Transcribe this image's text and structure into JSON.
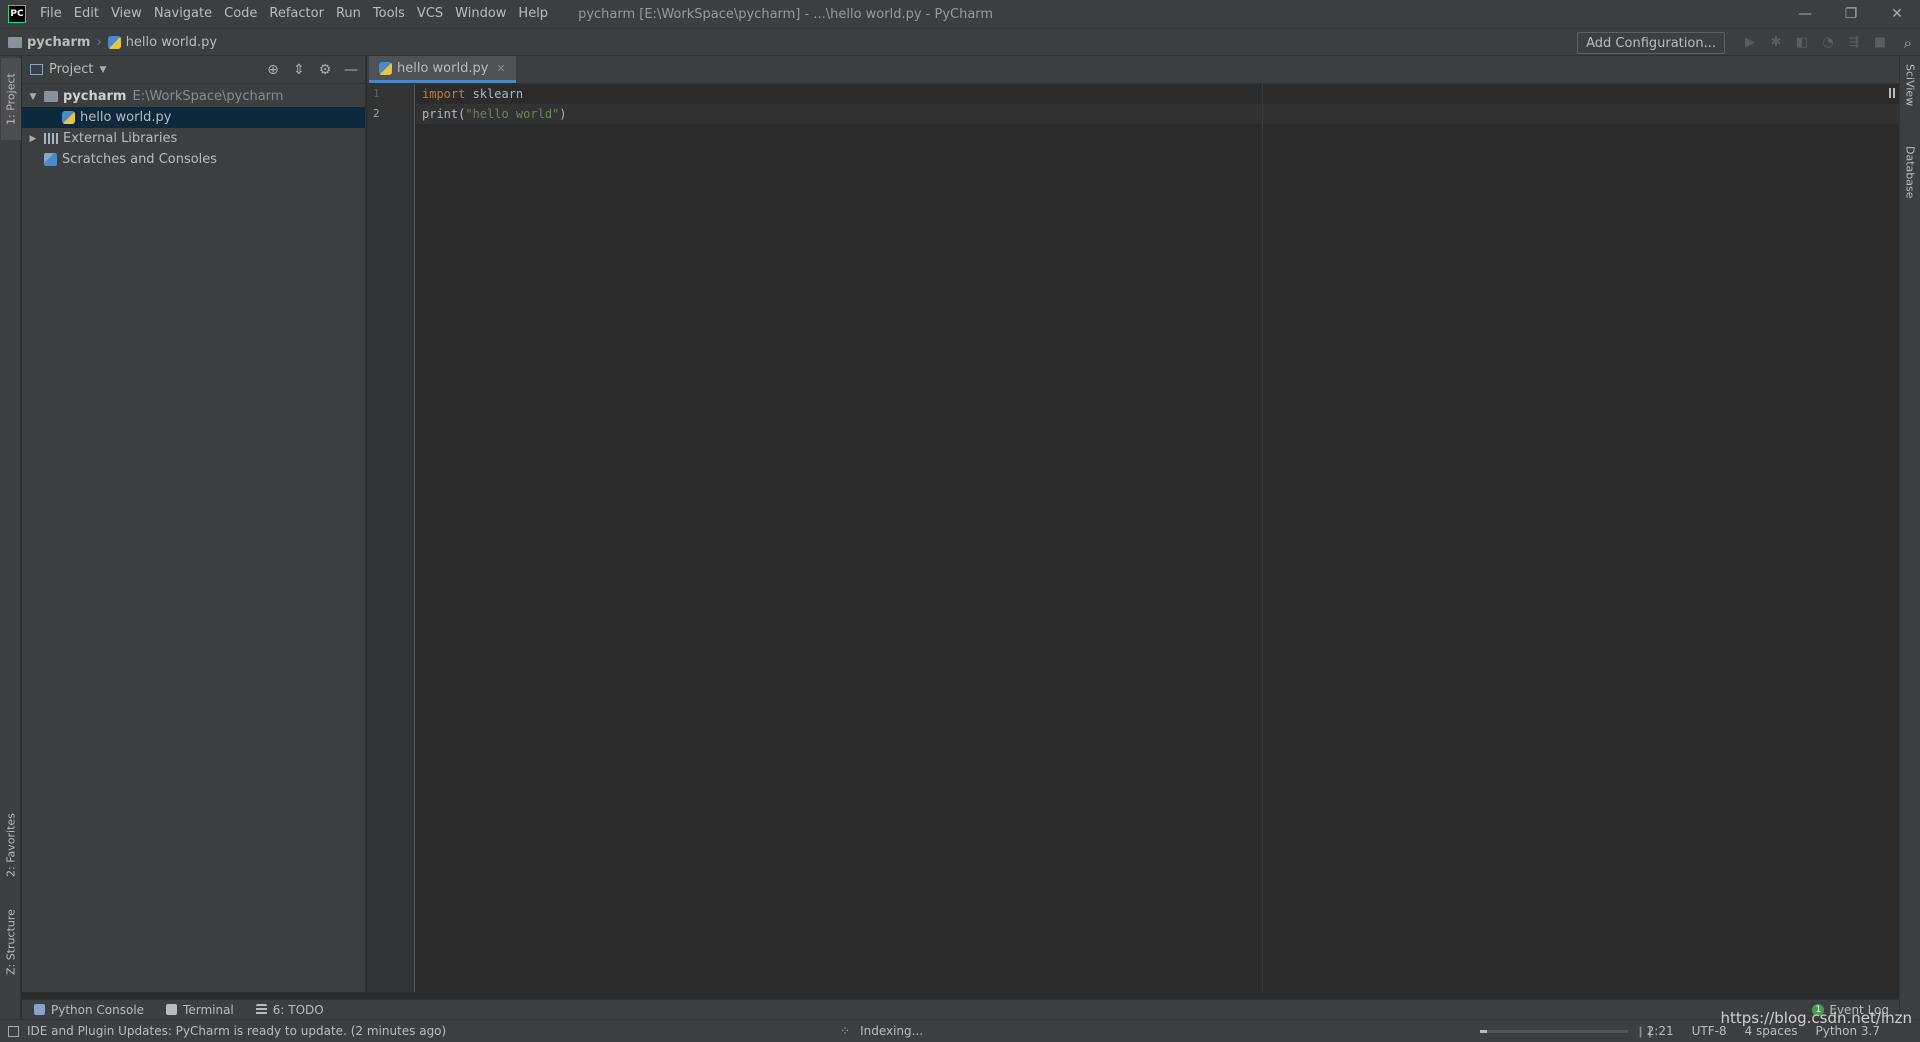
{
  "app": {
    "logo": "PC",
    "window_title": "pycharm [E:\\WorkSpace\\pycharm] - ...\\hello world.py - PyCharm"
  },
  "menu": [
    "File",
    "Edit",
    "View",
    "Navigate",
    "Code",
    "Refactor",
    "Run",
    "Tools",
    "VCS",
    "Window",
    "Help"
  ],
  "window_controls": {
    "minimize": "—",
    "restore": "❐",
    "close": "✕"
  },
  "navbar": {
    "root": "pycharm",
    "file": "hello world.py",
    "add_configuration": "Add Configuration..."
  },
  "left_stripe": {
    "project": "1: Project",
    "favorites": "2: Favorites",
    "structure": "Z: Structure"
  },
  "right_stripe": {
    "sciview": "SciView",
    "database": "Database"
  },
  "project_panel": {
    "title": "Project",
    "tree": [
      {
        "label": "pycharm",
        "path": "E:\\WorkSpace\\pycharm"
      },
      {
        "label": "hello world.py"
      },
      {
        "label": "External Libraries"
      },
      {
        "label": "Scratches and Consoles"
      }
    ]
  },
  "editor": {
    "tab_label": "hello world.py",
    "line_numbers": [
      "1",
      "2"
    ],
    "lines": [
      {
        "kw": "import",
        "rest": " sklearn"
      },
      {
        "fn": "print(",
        "str": "\"hello world\"",
        "end": ")"
      }
    ]
  },
  "toolwindows": {
    "python_console": "Python Console",
    "terminal": "Terminal",
    "todo": "6: TODO",
    "event_log": "Event Log",
    "event_count": "1"
  },
  "status": {
    "message": "IDE and Plugin Updates: PyCharm is ready to update. (2 minutes ago)",
    "indexing": "Indexing...",
    "indexing_progress": 0.05,
    "position": "2:21",
    "encoding": "UTF-8",
    "indent": "4 spaces",
    "interpreter": "Python 3.7"
  },
  "watermark": "https://blog.csdn.net/lnzn"
}
